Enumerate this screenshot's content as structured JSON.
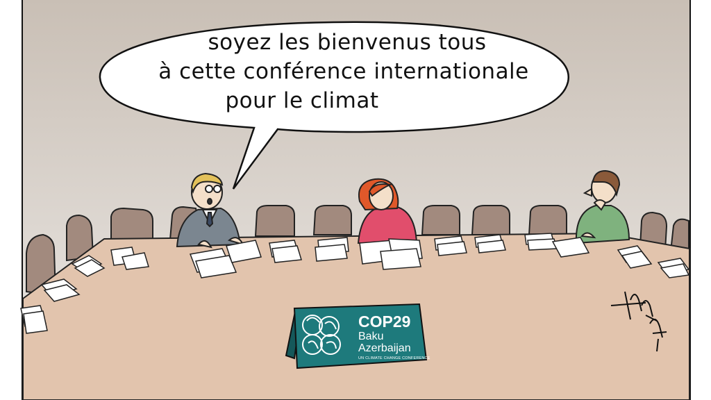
{
  "speech_bubble": {
    "line1": "soyez les bienvenus tous",
    "line2": "à cette conférence internationale",
    "line3": "pour le climat"
  },
  "table_sign": {
    "title": "COP29",
    "city": "Baku",
    "country": "Azerbaijan",
    "subtitle": "UN CLIMATE CHANGE CONFERENCE"
  },
  "signature": "ARENDVANDAM",
  "colors": {
    "wall_top": "#c9bfb5",
    "wall_bottom": "#ece9e6",
    "table": "#e2c4ad",
    "chair": "#a28a7e",
    "sign_teal": "#1e7a7c",
    "woman_top": "#e14e6c",
    "woman_hair": "#e0582a",
    "right_man_shirt": "#7fb27e",
    "left_man_suit": "#7b8690"
  }
}
